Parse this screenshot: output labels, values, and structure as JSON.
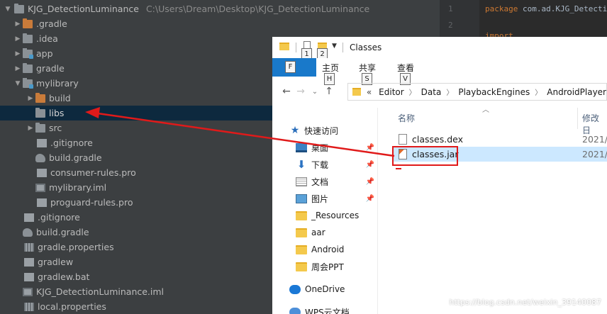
{
  "ide": {
    "project_name": "KJG_DetectionLuminance",
    "project_path": "C:\\Users\\Dream\\Desktop\\KJG_DetectionLuminance",
    "tree": [
      {
        "label": ".gradle",
        "icon": "folder-orange-icon",
        "chev": "▶",
        "indent": 1
      },
      {
        "label": ".idea",
        "icon": "folder-icon",
        "chev": "▶",
        "indent": 1
      },
      {
        "label": "app",
        "icon": "module-folder-icon",
        "chev": "▶",
        "indent": 1
      },
      {
        "label": "gradle",
        "icon": "folder-icon",
        "chev": "▶",
        "indent": 1
      },
      {
        "label": "mylibrary",
        "icon": "module-folder-icon",
        "chev": "▼",
        "indent": 1
      },
      {
        "label": "build",
        "icon": "folder-orange-icon",
        "chev": "▶",
        "indent": 2
      },
      {
        "label": "libs",
        "icon": "folder-icon",
        "chev": "",
        "indent": 2,
        "selected": true
      },
      {
        "label": "src",
        "icon": "folder-icon",
        "chev": "▶",
        "indent": 2
      },
      {
        "label": ".gitignore",
        "icon": "file-icon",
        "chev": "",
        "indent": 2
      },
      {
        "label": "build.gradle",
        "icon": "gradle-icon",
        "chev": "",
        "indent": 2
      },
      {
        "label": "consumer-rules.pro",
        "icon": "file-icon",
        "chev": "",
        "indent": 2
      },
      {
        "label": "mylibrary.iml",
        "icon": "iml-icon",
        "chev": "",
        "indent": 2
      },
      {
        "label": "proguard-rules.pro",
        "icon": "file-icon",
        "chev": "",
        "indent": 2
      },
      {
        "label": ".gitignore",
        "icon": "file-icon",
        "chev": "",
        "indent": 1
      },
      {
        "label": "build.gradle",
        "icon": "gradle-icon",
        "chev": "",
        "indent": 1
      },
      {
        "label": "gradle.properties",
        "icon": "properties-icon",
        "chev": "",
        "indent": 1
      },
      {
        "label": "gradlew",
        "icon": "file-icon",
        "chev": "",
        "indent": 1
      },
      {
        "label": "gradlew.bat",
        "icon": "file-icon",
        "chev": "",
        "indent": 1
      },
      {
        "label": "KJG_DetectionLuminance.iml",
        "icon": "iml-icon",
        "chev": "",
        "indent": 1
      },
      {
        "label": "local.properties",
        "icon": "properties-icon",
        "chev": "",
        "indent": 1
      }
    ]
  },
  "editor": {
    "line_numbers": [
      "1",
      "2",
      "3"
    ],
    "line1_keyword": "package",
    "line1_rest": "com.ad.KJG_DetectionL",
    "line3_keyword": "import"
  },
  "explorer": {
    "title": "Classes",
    "qat_keys": [
      "1",
      "2"
    ],
    "ribbon": {
      "file_key": "F",
      "tabs": [
        {
          "label": "主页",
          "key": "H"
        },
        {
          "label": "共享",
          "key": "S"
        },
        {
          "label": "查看",
          "key": "V"
        }
      ]
    },
    "address": [
      "Editor",
      "Data",
      "PlaybackEngines",
      "AndroidPlayer"
    ],
    "address_prefix": "«",
    "nav": [
      {
        "label": "快速访问",
        "icon": "star-icon",
        "pinned": false
      },
      {
        "label": "桌面",
        "icon": "desktop-icon",
        "pinned": true
      },
      {
        "label": "下载",
        "icon": "download-icon",
        "pinned": true
      },
      {
        "label": "文档",
        "icon": "documents-icon",
        "pinned": true
      },
      {
        "label": "图片",
        "icon": "pictures-icon",
        "pinned": true
      },
      {
        "label": "_Resources",
        "icon": "folder-icon",
        "pinned": false
      },
      {
        "label": "aar",
        "icon": "folder-icon",
        "pinned": false
      },
      {
        "label": "Android",
        "icon": "folder-icon",
        "pinned": false
      },
      {
        "label": "周会PPT",
        "icon": "folder-icon",
        "pinned": false
      },
      {
        "label": "OneDrive",
        "icon": "onedrive-icon",
        "pinned": false
      },
      {
        "label": "WPS云文档",
        "icon": "wps-cloud-icon",
        "pinned": false
      }
    ],
    "columns": {
      "name": "名称",
      "modified": "修改日"
    },
    "files": [
      {
        "name": "classes.dex",
        "date": "2021/",
        "icon": "dex-file-icon",
        "selected": false
      },
      {
        "name": "classes.jar",
        "date": "2021/",
        "icon": "jar-file-icon",
        "selected": true
      }
    ]
  },
  "watermark": "https://blog.csdn.net/weixin_39140087",
  "colors": {
    "ide_bg": "#3c3f41",
    "selection": "#0d293e",
    "ribbon_blue": "#1979ca",
    "annotation_red": "#e01a1a"
  }
}
